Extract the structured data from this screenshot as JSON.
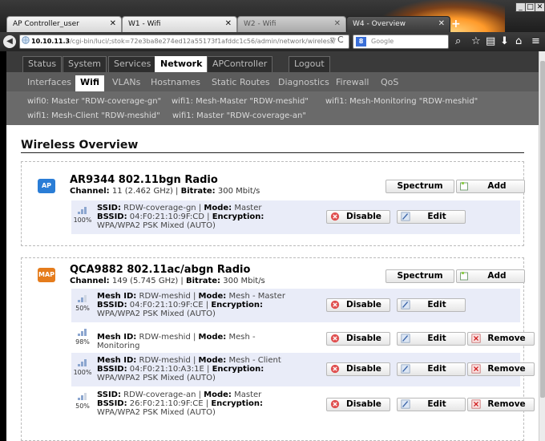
{
  "browser": {
    "tabs": [
      "AP Controller_user",
      "W1 - Wifi",
      "W2 - Wifi",
      "W4 - Overview"
    ],
    "url_host": "10.10.11.3",
    "url_path": "/cgi-bin/luci/;stok=72e3ba8e274ed12a55173f1afddc1c56/admin/network/wireless/",
    "search_placeholder": "Google",
    "search_engine_letter": "8"
  },
  "menu": {
    "main": [
      "Status",
      "System",
      "Services",
      "Network",
      "APController",
      "Logout"
    ],
    "sub": [
      "Interfaces",
      "Wifi",
      "VLANs",
      "Hostnames",
      "Static Routes",
      "Diagnostics",
      "Firewall",
      "QoS"
    ],
    "interfaces": [
      "wifi0: Master \"RDW-coverage-gn\"",
      "wifi1: Mesh-Master \"RDW-meshid\"",
      "wifi1: Mesh-Monitoring \"RDW-meshid\"",
      "wifi1: Mesh-Client \"RDW-meshid\"",
      "wifi1: Master \"RDW-coverage-an\""
    ]
  },
  "page": {
    "title": "Wireless Overview"
  },
  "labels": {
    "spectrum": "Spectrum",
    "add": "Add",
    "disable": "Disable",
    "edit": "Edit",
    "remove": "Remove",
    "channel": "Channel:",
    "bitrate": "Bitrate:",
    "ssid": "SSID:",
    "mesh_id": "Mesh ID:",
    "mode": "Mode:",
    "bssid": "BSSID:",
    "encryption": "Encryption:"
  },
  "radios": [
    {
      "badge": "AP",
      "name": "AR9344 802.11bgn Radio",
      "channel": "11 (2.462 GHz)",
      "bitrate": "300 Mbit/s",
      "networks": [
        {
          "signal": "100%",
          "id": "RDW-coverage-gn",
          "mode": "Master",
          "bssid": "04:F0:21:10:9F:CD",
          "encryption": "WPA/WPA2 PSK Mixed (AUTO)"
        }
      ]
    },
    {
      "badge": "MAP",
      "name": "QCA9882 802.11ac/abgn Radio",
      "channel": "149 (5.745 GHz)",
      "bitrate": "300 Mbit/s",
      "networks": [
        {
          "signal": "50%",
          "id": "RDW-meshid",
          "mode": "Mesh - Master",
          "bssid": "04:F0:21:10:9F:CE",
          "encryption": "WPA/WPA2 PSK Mixed (AUTO)"
        },
        {
          "signal": "98%",
          "id": "RDW-meshid",
          "mode": "Mesh - Monitoring"
        },
        {
          "signal": "100%",
          "id": "RDW-meshid",
          "mode": "Mesh - Client",
          "bssid": "04:F0:21:10:A3:1E",
          "encryption": "WPA/WPA2 PSK Mixed (AUTO)"
        },
        {
          "signal": "50%",
          "id": "RDW-coverage-an",
          "mode": "Master",
          "bssid": "26:F0:21:10:9F:CE",
          "encryption": "WPA/WPA2 PSK Mixed (AUTO)"
        }
      ]
    }
  ]
}
